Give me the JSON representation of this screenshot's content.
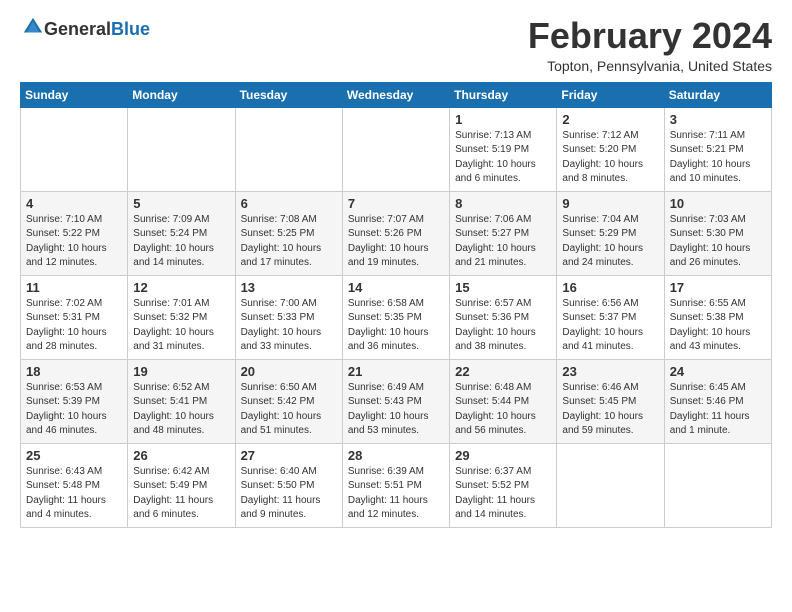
{
  "logo": {
    "general": "General",
    "blue": "Blue"
  },
  "title": "February 2024",
  "location": "Topton, Pennsylvania, United States",
  "headers": [
    "Sunday",
    "Monday",
    "Tuesday",
    "Wednesday",
    "Thursday",
    "Friday",
    "Saturday"
  ],
  "weeks": [
    [
      {
        "day": "",
        "info": ""
      },
      {
        "day": "",
        "info": ""
      },
      {
        "day": "",
        "info": ""
      },
      {
        "day": "",
        "info": ""
      },
      {
        "day": "1",
        "info": "Sunrise: 7:13 AM\nSunset: 5:19 PM\nDaylight: 10 hours\nand 6 minutes."
      },
      {
        "day": "2",
        "info": "Sunrise: 7:12 AM\nSunset: 5:20 PM\nDaylight: 10 hours\nand 8 minutes."
      },
      {
        "day": "3",
        "info": "Sunrise: 7:11 AM\nSunset: 5:21 PM\nDaylight: 10 hours\nand 10 minutes."
      }
    ],
    [
      {
        "day": "4",
        "info": "Sunrise: 7:10 AM\nSunset: 5:22 PM\nDaylight: 10 hours\nand 12 minutes."
      },
      {
        "day": "5",
        "info": "Sunrise: 7:09 AM\nSunset: 5:24 PM\nDaylight: 10 hours\nand 14 minutes."
      },
      {
        "day": "6",
        "info": "Sunrise: 7:08 AM\nSunset: 5:25 PM\nDaylight: 10 hours\nand 17 minutes."
      },
      {
        "day": "7",
        "info": "Sunrise: 7:07 AM\nSunset: 5:26 PM\nDaylight: 10 hours\nand 19 minutes."
      },
      {
        "day": "8",
        "info": "Sunrise: 7:06 AM\nSunset: 5:27 PM\nDaylight: 10 hours\nand 21 minutes."
      },
      {
        "day": "9",
        "info": "Sunrise: 7:04 AM\nSunset: 5:29 PM\nDaylight: 10 hours\nand 24 minutes."
      },
      {
        "day": "10",
        "info": "Sunrise: 7:03 AM\nSunset: 5:30 PM\nDaylight: 10 hours\nand 26 minutes."
      }
    ],
    [
      {
        "day": "11",
        "info": "Sunrise: 7:02 AM\nSunset: 5:31 PM\nDaylight: 10 hours\nand 28 minutes."
      },
      {
        "day": "12",
        "info": "Sunrise: 7:01 AM\nSunset: 5:32 PM\nDaylight: 10 hours\nand 31 minutes."
      },
      {
        "day": "13",
        "info": "Sunrise: 7:00 AM\nSunset: 5:33 PM\nDaylight: 10 hours\nand 33 minutes."
      },
      {
        "day": "14",
        "info": "Sunrise: 6:58 AM\nSunset: 5:35 PM\nDaylight: 10 hours\nand 36 minutes."
      },
      {
        "day": "15",
        "info": "Sunrise: 6:57 AM\nSunset: 5:36 PM\nDaylight: 10 hours\nand 38 minutes."
      },
      {
        "day": "16",
        "info": "Sunrise: 6:56 AM\nSunset: 5:37 PM\nDaylight: 10 hours\nand 41 minutes."
      },
      {
        "day": "17",
        "info": "Sunrise: 6:55 AM\nSunset: 5:38 PM\nDaylight: 10 hours\nand 43 minutes."
      }
    ],
    [
      {
        "day": "18",
        "info": "Sunrise: 6:53 AM\nSunset: 5:39 PM\nDaylight: 10 hours\nand 46 minutes."
      },
      {
        "day": "19",
        "info": "Sunrise: 6:52 AM\nSunset: 5:41 PM\nDaylight: 10 hours\nand 48 minutes."
      },
      {
        "day": "20",
        "info": "Sunrise: 6:50 AM\nSunset: 5:42 PM\nDaylight: 10 hours\nand 51 minutes."
      },
      {
        "day": "21",
        "info": "Sunrise: 6:49 AM\nSunset: 5:43 PM\nDaylight: 10 hours\nand 53 minutes."
      },
      {
        "day": "22",
        "info": "Sunrise: 6:48 AM\nSunset: 5:44 PM\nDaylight: 10 hours\nand 56 minutes."
      },
      {
        "day": "23",
        "info": "Sunrise: 6:46 AM\nSunset: 5:45 PM\nDaylight: 10 hours\nand 59 minutes."
      },
      {
        "day": "24",
        "info": "Sunrise: 6:45 AM\nSunset: 5:46 PM\nDaylight: 11 hours\nand 1 minute."
      }
    ],
    [
      {
        "day": "25",
        "info": "Sunrise: 6:43 AM\nSunset: 5:48 PM\nDaylight: 11 hours\nand 4 minutes."
      },
      {
        "day": "26",
        "info": "Sunrise: 6:42 AM\nSunset: 5:49 PM\nDaylight: 11 hours\nand 6 minutes."
      },
      {
        "day": "27",
        "info": "Sunrise: 6:40 AM\nSunset: 5:50 PM\nDaylight: 11 hours\nand 9 minutes."
      },
      {
        "day": "28",
        "info": "Sunrise: 6:39 AM\nSunset: 5:51 PM\nDaylight: 11 hours\nand 12 minutes."
      },
      {
        "day": "29",
        "info": "Sunrise: 6:37 AM\nSunset: 5:52 PM\nDaylight: 11 hours\nand 14 minutes."
      },
      {
        "day": "",
        "info": ""
      },
      {
        "day": "",
        "info": ""
      }
    ]
  ]
}
